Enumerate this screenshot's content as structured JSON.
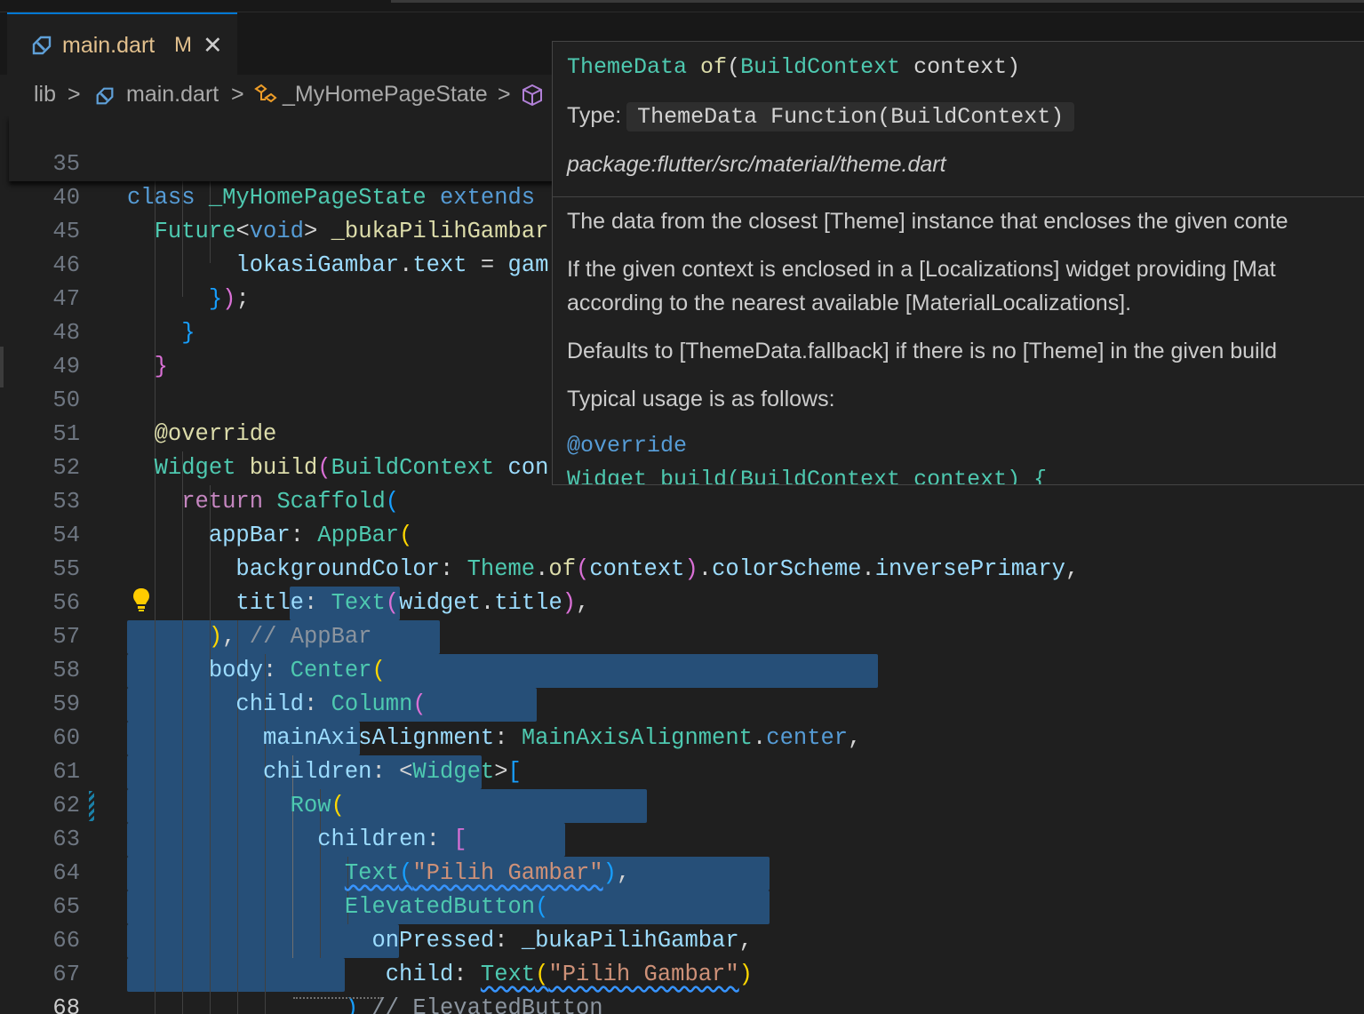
{
  "tab": {
    "icon": "dart-file-icon",
    "label": "main.dart",
    "badge": "M",
    "close": "✕"
  },
  "breadcrumb": {
    "items": [
      "lib",
      "main.dart",
      "_MyHomePageState"
    ],
    "separator": ">"
  },
  "sticky": [
    {
      "num": "35",
      "text": "class _MyHomePageState extends"
    },
    {
      "num": "40",
      "text": "Future<void> _bukaPilihGambar"
    }
  ],
  "lines": [
    {
      "num": "45",
      "text": "lokasiGambar.text = gam"
    },
    {
      "num": "46",
      "text": "});"
    },
    {
      "num": "47",
      "text": "}"
    },
    {
      "num": "48",
      "text": "}"
    },
    {
      "num": "49",
      "text": ""
    },
    {
      "num": "50",
      "text": "@override"
    },
    {
      "num": "51",
      "text": "Widget build(BuildContext con"
    },
    {
      "num": "52",
      "text": "return Scaffold("
    },
    {
      "num": "53",
      "text": "appBar: AppBar("
    },
    {
      "num": "54",
      "text": "backgroundColor: Theme.of(context).colorScheme.inversePrimary,"
    },
    {
      "num": "55",
      "text": "title: Text(widget.title),"
    },
    {
      "num": "56",
      "text": "), // AppBar"
    },
    {
      "num": "57",
      "text": "body: Center("
    },
    {
      "num": "58",
      "text": "child: Column("
    },
    {
      "num": "59",
      "text": "mainAxisAlignment: MainAxisAlignment.center,"
    },
    {
      "num": "60",
      "text": "children: <Widget>["
    },
    {
      "num": "61",
      "text": "Row("
    },
    {
      "num": "62",
      "text": "children: ["
    },
    {
      "num": "63",
      "text": "Text(\"Pilih Gambar\"),"
    },
    {
      "num": "64",
      "text": "ElevatedButton("
    },
    {
      "num": "65",
      "text": "onPressed: _bukaPilihGambar,"
    },
    {
      "num": "66",
      "text": "child: Text(\"Pilih Gambar\")"
    },
    {
      "num": "67",
      "text": ") // ElevatedButton"
    },
    {
      "num": "68",
      "text": "],"
    }
  ],
  "hover": {
    "signature": "ThemeData of(BuildContext context)",
    "type_label": "Type:",
    "type_value": "ThemeData Function(BuildContext)",
    "package": "package:flutter/src/material/theme.dart",
    "paragraphs": [
      "The data from the closest [Theme] instance that encloses the given conte",
      "If the given context is enclosed in a [Localizations] widget providing [Mat",
      "according to the nearest available [MaterialLocalizations].",
      "Defaults to [ThemeData.fallback] if there is no [Theme] in the given build",
      "Typical usage is as follows:"
    ],
    "code": [
      "@override",
      "Widget build(BuildContext context) {"
    ]
  },
  "colors": {
    "background": "#1f1f1f",
    "selection": "#264f78",
    "tab_accent": "#0078d4",
    "modified": "#e2c08d"
  }
}
